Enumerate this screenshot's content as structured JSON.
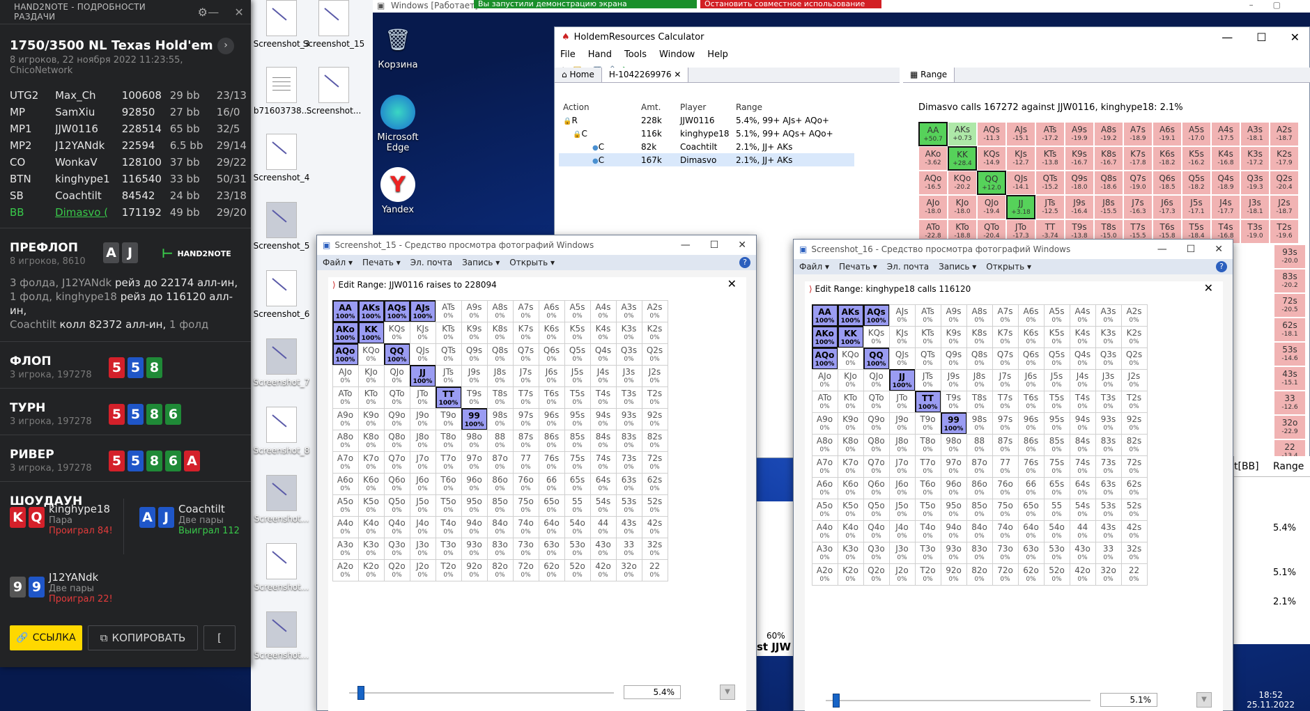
{
  "h2n": {
    "window_title": "HAND2NOTE - ПОДРОБНОСТИ РАЗДАЧИ",
    "game_title": "1750/3500 NL Texas Hold'em",
    "game_sub": "8 игроков, 22 ноября 2022 11:23:55, ChicoNetwork",
    "players": [
      {
        "pos": "UTG2",
        "name": "Max_Ch",
        "chips": "100608",
        "bb": "29 bb",
        "stat": "23/13"
      },
      {
        "pos": "MP",
        "name": "SamXiu",
        "chips": "92850",
        "bb": "27 bb",
        "stat": "16/0"
      },
      {
        "pos": "MP1",
        "name": "JJW0116",
        "chips": "228514",
        "bb": "65 bb",
        "stat": "32/5"
      },
      {
        "pos": "MP2",
        "name": "J12YANdk",
        "chips": "22594",
        "bb": "6.5 bb",
        "stat": "29/14"
      },
      {
        "pos": "CO",
        "name": "WonkaV",
        "chips": "128100",
        "bb": "37 bb",
        "stat": "29/22"
      },
      {
        "pos": "BTN",
        "name": "kinghype1",
        "chips": "116540",
        "bb": "33 bb",
        "stat": "50/31"
      },
      {
        "pos": "SB",
        "name": "Coachtilt",
        "chips": "84542",
        "bb": "24 bb",
        "stat": "23/18"
      },
      {
        "pos": "BB",
        "name": "Dimasvo (",
        "chips": "171192",
        "bb": "49 bb",
        "stat": "29/20"
      }
    ],
    "preflop": {
      "name": "ПРЕФЛОП",
      "sub": "8 игроков, 8610",
      "cards": [
        "A",
        "J"
      ],
      "logo": "HAND2NOTE"
    },
    "preflop_actions": {
      "l1a": "3 фолда, J12YANdk ",
      "l1b": "рейз до 22174 алл-ин,",
      "l2a": "1 фолд, kinghype18 ",
      "l2b": "рейз до 116120 алл-ин,",
      "l3a": "Coachtilt ",
      "l3b": "колл 82372 алл-ин, ",
      "l3c": "1 фолд"
    },
    "flop": {
      "name": "ФЛОП",
      "sub": "3 игрока, 197278",
      "cards": [
        "5",
        "5",
        "8"
      ]
    },
    "turn": {
      "name": "ТУРН",
      "sub": "3 игрока, 197278",
      "cards": [
        "5",
        "5",
        "8",
        "6"
      ]
    },
    "river": {
      "name": "РИВЕР",
      "sub": "3 игрока, 197278",
      "cards": [
        "5",
        "5",
        "8",
        "6",
        "A"
      ]
    },
    "showdown": {
      "title": "ШОУДАУН",
      "p1": {
        "cards": [
          "K",
          "Q"
        ],
        "name": "kinghype18",
        "hand": "Пара",
        "result": "Проиграл 84!"
      },
      "p2": {
        "cards": [
          "A",
          "J"
        ],
        "name": "Coachtilt",
        "hand": "Две пары",
        "result": "Выиграл 112"
      },
      "p3": {
        "cards": [
          "9",
          "9"
        ],
        "name": "J12YANdk",
        "hand": "Две пары",
        "result": "Проиграл 22!"
      }
    },
    "link_btn": "ССЫЛКА",
    "copy_btn": "КОПИРОВАТЬ",
    "extra_btn": "["
  },
  "desktop": {
    "icons": [
      "Screenshot_3",
      "Screenshot_15",
      "b71603738...",
      "Screenshot...",
      "Screenshot_4",
      "Screenshot_5",
      "Screenshot_6",
      "Screenshot_7",
      "Screenshot_8",
      "Screenshot...",
      "Screenshot...",
      "Screenshot..."
    ],
    "sys_icons": [
      "Корзина",
      "Microsoft Edge",
      "Yandex"
    ]
  },
  "vm": {
    "title": "Windows [Работает]",
    "notice_green": "Вы запустили демонстрацию экрана",
    "notice_red": "Остановить совместное использование"
  },
  "hr": {
    "title": "HoldemResources Calculator",
    "menu": [
      "File",
      "Hand",
      "Tools",
      "Window",
      "Help"
    ],
    "tab_home": "Home",
    "tab_hand": "H-1042269976",
    "tab_range": "Range",
    "cols": [
      "Action",
      "Amt.",
      "Player",
      "Range"
    ],
    "rows": [
      {
        "act": "R",
        "amt": "228k",
        "player": "JJW0116",
        "range": "5.4%, 99+ AJs+ AQo+"
      },
      {
        "act": "C",
        "amt": "116k",
        "player": "kinghype18",
        "range": "5.1%, 99+ AQs+ AQo+"
      },
      {
        "act": "C",
        "amt": "82k",
        "player": "Coachtilt",
        "range": "2.1%, JJ+ AKs"
      },
      {
        "act": "C",
        "amt": "167k",
        "player": "Dimasvo",
        "range": "2.1%, JJ+ AKs"
      }
    ],
    "range_caption": "Dimasvo calls 167272 against JJW0116, kinghype18: 2.1%",
    "lower_cols": [
      "t[BB]",
      "Range"
    ],
    "lower_vals": [
      "5.4%",
      "5.1%",
      "2.1%"
    ],
    "grid": [
      [
        [
          "AA",
          "+50.7"
        ],
        [
          "AKs",
          "+0.73"
        ],
        [
          "AQs",
          "-11.3"
        ],
        [
          "AJs",
          "-15.1"
        ],
        [
          "ATs",
          "-17.2"
        ],
        [
          "A9s",
          "-19.9"
        ],
        [
          "A8s",
          "-19.2"
        ],
        [
          "A7s",
          "-18.9"
        ],
        [
          "A6s",
          "-19.1"
        ],
        [
          "A5s",
          "-17.0"
        ],
        [
          "A4s",
          "-17.5"
        ],
        [
          "A3s",
          "-18.1"
        ],
        [
          "A2s",
          "-18.7"
        ]
      ],
      [
        [
          "AKo",
          "-3.62"
        ],
        [
          "KK",
          "+28.4"
        ],
        [
          "KQs",
          "-14.9"
        ],
        [
          "KJs",
          "-12.7"
        ],
        [
          "KTs",
          "-13.8"
        ],
        [
          "K9s",
          "-16.7"
        ],
        [
          "K8s",
          "-16.7"
        ],
        [
          "K7s",
          "-17.8"
        ],
        [
          "K6s",
          "-18.2"
        ],
        [
          "K5s",
          "-16.2"
        ],
        [
          "K4s",
          "-16.8"
        ],
        [
          "K3s",
          "-17.2"
        ],
        [
          "K2s",
          "-17.9"
        ]
      ],
      [
        [
          "AQo",
          "-16.5"
        ],
        [
          "KQo",
          "-20.2"
        ],
        [
          "QQ",
          "+12.0"
        ],
        [
          "QJs",
          "-14.1"
        ],
        [
          "QTs",
          "-15.2"
        ],
        [
          "Q9s",
          "-18.0"
        ],
        [
          "Q8s",
          "-18.6"
        ],
        [
          "Q7s",
          "-19.0"
        ],
        [
          "Q6s",
          "-18.5"
        ],
        [
          "Q5s",
          "-18.2"
        ],
        [
          "Q4s",
          "-18.9"
        ],
        [
          "Q3s",
          "-19.3"
        ],
        [
          "Q2s",
          "-20.4"
        ]
      ],
      [
        [
          "AJo",
          "-18.0"
        ],
        [
          "KJo",
          "-18.0"
        ],
        [
          "QJo",
          "-19.4"
        ],
        [
          "JJ",
          "+3.18"
        ],
        [
          "JTs",
          "-12.5"
        ],
        [
          "J9s",
          "-16.4"
        ],
        [
          "J8s",
          "-15.5"
        ],
        [
          "J7s",
          "-16.3"
        ],
        [
          "J6s",
          "-17.3"
        ],
        [
          "J5s",
          "-17.1"
        ],
        [
          "J4s",
          "-17.7"
        ],
        [
          "J3s",
          "-18.1"
        ],
        [
          "J2s",
          "-18.7"
        ]
      ],
      [
        [
          "ATo",
          "-22.8"
        ],
        [
          "KTo",
          "-18.8"
        ],
        [
          "QTo",
          "-20.4"
        ],
        [
          "JTo",
          "-17.3"
        ],
        [
          "TT",
          "-3.74"
        ],
        [
          "T9s",
          "-13.8"
        ],
        [
          "T8s",
          "-15.0"
        ],
        [
          "T7s",
          "-15.5"
        ],
        [
          "T6s",
          "-15.8"
        ],
        [
          "T5s",
          "-18.4"
        ],
        [
          "T4s",
          "-16.8"
        ],
        [
          "T3s",
          "-19.0"
        ],
        [
          "T2s",
          "-19.6"
        ]
      ]
    ],
    "right_column": [
      [
        "93s",
        "-20.0"
      ],
      [
        "83s",
        "-20.2"
      ],
      [
        "72s",
        "-20.5"
      ],
      [
        "62s",
        "-18.1"
      ],
      [
        "53s",
        "-14.6"
      ],
      [
        "43s",
        "-15.1"
      ],
      [
        "33",
        "-12.6"
      ],
      [
        "32o",
        "-22.9"
      ],
      [
        "22",
        "-13.4"
      ]
    ]
  },
  "viewer1": {
    "title": "Screenshot_15 - Средство просмотра фотографий Windows",
    "menu": [
      "Файл",
      "Печать",
      "Эл. почта",
      "Запись",
      "Открыть"
    ],
    "edit_title": "Edit Range: JJW0116 raises to 228094",
    "pct": "5.4%",
    "on": [
      "AA",
      "AKs",
      "AQs",
      "AJs",
      "AKo",
      "KK",
      "AQo",
      "QQ",
      "JJ",
      "TT",
      "99"
    ]
  },
  "viewer2": {
    "title": "Screenshot_16 - Средство просмотра фотографий Windows",
    "menu": [
      "Файл",
      "Печать",
      "Эл. почта",
      "Запись",
      "Открыть"
    ],
    "edit_title": "Edit Range: kinghype18 calls 116120",
    "pct": "5.1%",
    "on": [
      "AA",
      "AKs",
      "AQs",
      "AKo",
      "KK",
      "AQo",
      "QQ",
      "JJ",
      "TT",
      "99"
    ]
  },
  "ranks": [
    "A",
    "K",
    "Q",
    "J",
    "T",
    "9",
    "8",
    "7",
    "6",
    "5",
    "4",
    "3",
    "2"
  ],
  "pct_zero": "0%",
  "pct_full": "100%",
  "behind": {
    "label_60": "60%",
    "label_jjw": "st JJW"
  },
  "clock": {
    "time": "18:52",
    "date": "25.11.2022"
  },
  "colors": {
    "h2n_bg": "#222325",
    "green": "#39c94a",
    "red": "#e33b3b",
    "yellow": "#ffd800",
    "range_on": "#9a9cf2"
  }
}
